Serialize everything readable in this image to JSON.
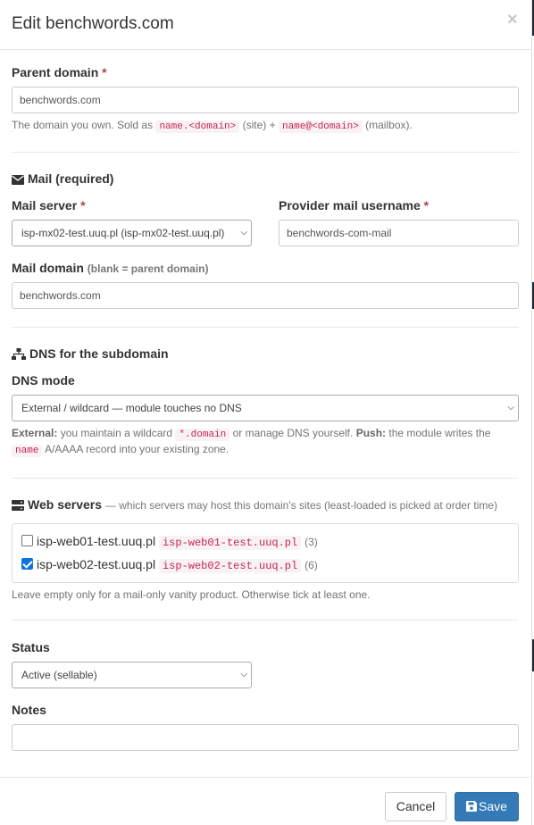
{
  "modal": {
    "title": "Edit benchwords.com",
    "close_symbol": "×"
  },
  "parent_domain": {
    "label": "Parent domain",
    "required_mark": "*",
    "value": "benchwords.com",
    "help_prefix": "The domain you own. Sold as",
    "help_code1": "name.<domain>",
    "help_mid": "(site) +",
    "help_code2": "name@<domain>",
    "help_suffix": "(mailbox)."
  },
  "mail_section": {
    "icon": "envelope-icon",
    "title": "Mail (required)",
    "mail_server_label": "Mail server",
    "mail_server_required": "*",
    "mail_server_value": "isp-mx02-test.uuq.pl (isp-mx02-test.uuq.pl)",
    "provider_label": "Provider mail username",
    "provider_required": "*",
    "provider_value": "benchwords-com-mail",
    "mail_domain_label": "Mail domain",
    "mail_domain_hint": "(blank = parent domain)",
    "mail_domain_value": "benchwords.com"
  },
  "dns_section": {
    "icon": "sitemap-icon",
    "title": "DNS for the subdomain",
    "mode_label": "DNS mode",
    "mode_value": "External / wildcard — module touches no DNS",
    "help_b1": "External:",
    "help_t1": "you maintain a wildcard",
    "help_code1": "*.domain",
    "help_t2": "or manage DNS yourself.",
    "help_b2": "Push:",
    "help_t3": "the module writes the",
    "help_code2": "name",
    "help_t4": "A/AAAA record into your existing zone."
  },
  "web_section": {
    "icon": "server-icon",
    "title": "Web servers",
    "subtitle": "— which servers may host this domain's sites (least-loaded is picked at order time)",
    "servers": [
      {
        "name": "isp-web01-test.uuq.pl",
        "code": "isp-web01-test.uuq.pl",
        "count": "(3)",
        "checked": false
      },
      {
        "name": "isp-web02-test.uuq.pl",
        "code": "isp-web02-test.uuq.pl",
        "count": "(6)",
        "checked": true
      }
    ],
    "help": "Leave empty only for a mail-only vanity product. Otherwise tick at least one."
  },
  "status": {
    "label": "Status",
    "value": "Active (sellable)"
  },
  "notes": {
    "label": "Notes",
    "value": ""
  },
  "footer": {
    "cancel_label": "Cancel",
    "save_label": "Save",
    "save_icon": "floppy-icon"
  },
  "colors": {
    "primary": "#337ab7",
    "required": "#a94442",
    "code_text": "#c7254e",
    "code_bg": "#f9f2f4"
  }
}
